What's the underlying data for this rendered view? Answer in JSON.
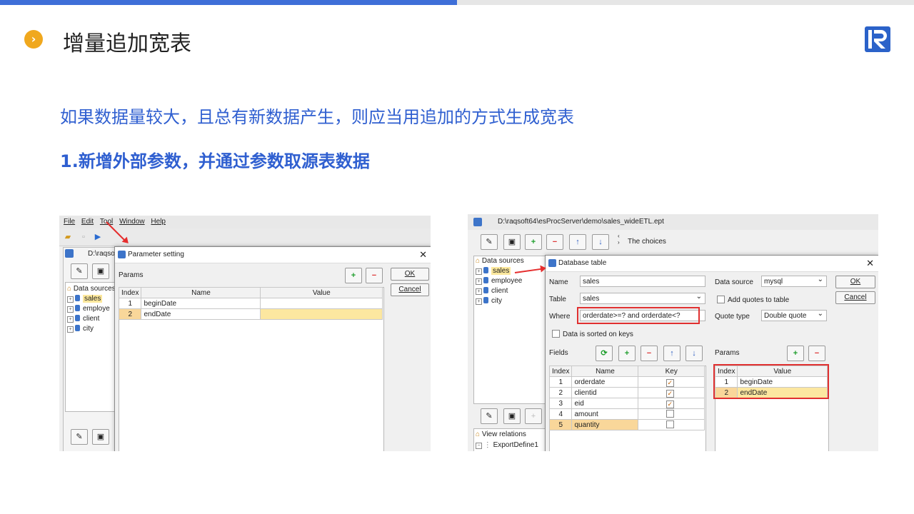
{
  "header": {
    "title": "增量追加宽表",
    "bullet": "›"
  },
  "subtitle": "如果数据量较大，且总有新数据产生，则应当用追加的方式生成宽表",
  "step": "1.新增外部参数，并通过参数取源表数据",
  "left": {
    "menu": [
      "File",
      "Edit",
      "Tool",
      "Window",
      "Help"
    ],
    "behind_path": "D:\\raqso",
    "tree_root": "Data sources",
    "tree_items": [
      "sales",
      "employe",
      "client",
      "city"
    ],
    "dialog": {
      "title": "Parameter setting",
      "params_label": "Params",
      "ok": "OK",
      "cancel": "Cancel",
      "headers": [
        "Index",
        "Name",
        "Value"
      ],
      "rows": [
        {
          "index": "1",
          "name": "beginDate",
          "value": ""
        },
        {
          "index": "2",
          "name": "endDate",
          "value": ""
        }
      ]
    }
  },
  "right": {
    "path": "D:\\raqsoft64\\esProcServer\\demo\\sales_wideETL.ept",
    "choices": "The choices",
    "tree_root": "Data sources",
    "tree_items": [
      "sales",
      "employee",
      "client",
      "city"
    ],
    "view_relations": "View relations",
    "export_define": "ExportDefine1",
    "dialog": {
      "title": "Database table",
      "name_label": "Name",
      "name_value": "sales",
      "table_label": "Table",
      "table_value": "sales",
      "where_label": "Where",
      "where_value": "orderdate>=? and orderdate<?",
      "sorted_label": "Data is sorted on keys",
      "datasource_label": "Data source",
      "datasource_value": "mysql",
      "quotes_label": "Add quotes to table",
      "quotetype_label": "Quote type",
      "quotetype_value": "Double quote",
      "ok": "OK",
      "cancel": "Cancel",
      "fields_label": "Fields",
      "params_label": "Params",
      "field_headers": [
        "Index",
        "Name",
        "Key"
      ],
      "fields": [
        {
          "index": "1",
          "name": "orderdate",
          "key": true
        },
        {
          "index": "2",
          "name": "clientid",
          "key": true
        },
        {
          "index": "3",
          "name": "eid",
          "key": true
        },
        {
          "index": "4",
          "name": "amount",
          "key": false
        },
        {
          "index": "5",
          "name": "quantity",
          "key": false
        }
      ],
      "param_headers": [
        "Index",
        "Value"
      ],
      "params": [
        {
          "index": "1",
          "value": "beginDate"
        },
        {
          "index": "2",
          "value": "endDate"
        }
      ]
    }
  },
  "colors": {
    "accent_blue": "#2f5fd0",
    "bullet_orange": "#f0a81e",
    "highlight_red": "#e03030"
  }
}
